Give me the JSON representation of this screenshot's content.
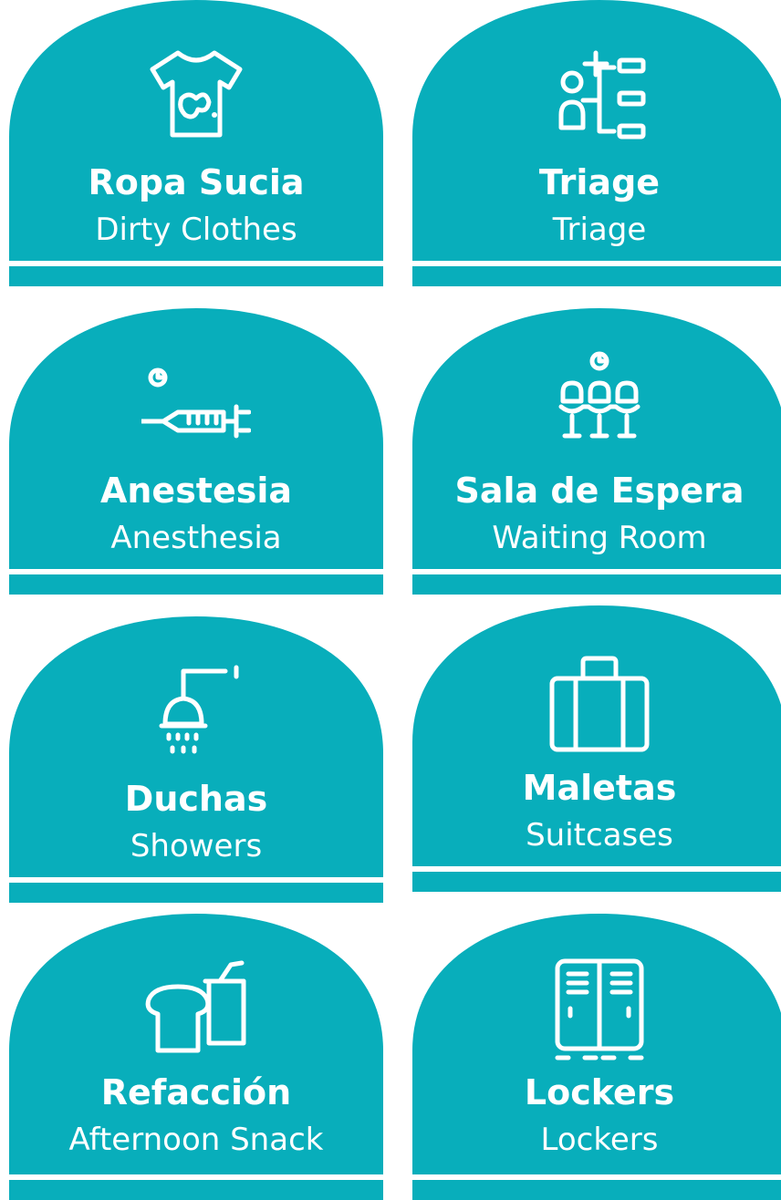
{
  "colors": {
    "sign_fill": "#08AEBB",
    "foreground": "#FFFFFF",
    "background": "#FFFFFF"
  },
  "signs": [
    {
      "icon": "dirty-shirt-icon",
      "title": "Ropa Sucia",
      "subtitle": "Dirty Clothes"
    },
    {
      "icon": "triage-icon",
      "title": "Triage",
      "subtitle": "Triage"
    },
    {
      "icon": "syringe-icon",
      "title": "Anestesia",
      "subtitle": "Anesthesia"
    },
    {
      "icon": "waiting-chairs-icon",
      "title": "Sala de Espera",
      "subtitle": "Waiting Room"
    },
    {
      "icon": "shower-icon",
      "title": "Duchas",
      "subtitle": "Showers"
    },
    {
      "icon": "suitcase-icon",
      "title": "Maletas",
      "subtitle": "Suitcases"
    },
    {
      "icon": "snack-icon",
      "title": "Refacción",
      "subtitle": "Afternoon Snack"
    },
    {
      "icon": "lockers-icon",
      "title": "Lockers",
      "subtitle": "Lockers"
    }
  ]
}
